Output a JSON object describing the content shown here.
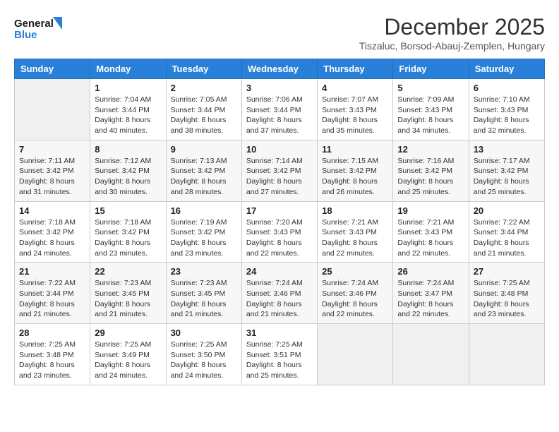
{
  "header": {
    "logo_line1": "General",
    "logo_line2": "Blue",
    "month_title": "December 2025",
    "location": "Tiszaluc, Borsod-Abauj-Zemplen, Hungary"
  },
  "days_of_week": [
    "Sunday",
    "Monday",
    "Tuesday",
    "Wednesday",
    "Thursday",
    "Friday",
    "Saturday"
  ],
  "weeks": [
    [
      {
        "day": "",
        "info": ""
      },
      {
        "day": "1",
        "info": "Sunrise: 7:04 AM\nSunset: 3:44 PM\nDaylight: 8 hours\nand 40 minutes."
      },
      {
        "day": "2",
        "info": "Sunrise: 7:05 AM\nSunset: 3:44 PM\nDaylight: 8 hours\nand 38 minutes."
      },
      {
        "day": "3",
        "info": "Sunrise: 7:06 AM\nSunset: 3:44 PM\nDaylight: 8 hours\nand 37 minutes."
      },
      {
        "day": "4",
        "info": "Sunrise: 7:07 AM\nSunset: 3:43 PM\nDaylight: 8 hours\nand 35 minutes."
      },
      {
        "day": "5",
        "info": "Sunrise: 7:09 AM\nSunset: 3:43 PM\nDaylight: 8 hours\nand 34 minutes."
      },
      {
        "day": "6",
        "info": "Sunrise: 7:10 AM\nSunset: 3:43 PM\nDaylight: 8 hours\nand 32 minutes."
      }
    ],
    [
      {
        "day": "7",
        "info": "Sunrise: 7:11 AM\nSunset: 3:42 PM\nDaylight: 8 hours\nand 31 minutes."
      },
      {
        "day": "8",
        "info": "Sunrise: 7:12 AM\nSunset: 3:42 PM\nDaylight: 8 hours\nand 30 minutes."
      },
      {
        "day": "9",
        "info": "Sunrise: 7:13 AM\nSunset: 3:42 PM\nDaylight: 8 hours\nand 28 minutes."
      },
      {
        "day": "10",
        "info": "Sunrise: 7:14 AM\nSunset: 3:42 PM\nDaylight: 8 hours\nand 27 minutes."
      },
      {
        "day": "11",
        "info": "Sunrise: 7:15 AM\nSunset: 3:42 PM\nDaylight: 8 hours\nand 26 minutes."
      },
      {
        "day": "12",
        "info": "Sunrise: 7:16 AM\nSunset: 3:42 PM\nDaylight: 8 hours\nand 25 minutes."
      },
      {
        "day": "13",
        "info": "Sunrise: 7:17 AM\nSunset: 3:42 PM\nDaylight: 8 hours\nand 25 minutes."
      }
    ],
    [
      {
        "day": "14",
        "info": "Sunrise: 7:18 AM\nSunset: 3:42 PM\nDaylight: 8 hours\nand 24 minutes."
      },
      {
        "day": "15",
        "info": "Sunrise: 7:18 AM\nSunset: 3:42 PM\nDaylight: 8 hours\nand 23 minutes."
      },
      {
        "day": "16",
        "info": "Sunrise: 7:19 AM\nSunset: 3:42 PM\nDaylight: 8 hours\nand 23 minutes."
      },
      {
        "day": "17",
        "info": "Sunrise: 7:20 AM\nSunset: 3:43 PM\nDaylight: 8 hours\nand 22 minutes."
      },
      {
        "day": "18",
        "info": "Sunrise: 7:21 AM\nSunset: 3:43 PM\nDaylight: 8 hours\nand 22 minutes."
      },
      {
        "day": "19",
        "info": "Sunrise: 7:21 AM\nSunset: 3:43 PM\nDaylight: 8 hours\nand 22 minutes."
      },
      {
        "day": "20",
        "info": "Sunrise: 7:22 AM\nSunset: 3:44 PM\nDaylight: 8 hours\nand 21 minutes."
      }
    ],
    [
      {
        "day": "21",
        "info": "Sunrise: 7:22 AM\nSunset: 3:44 PM\nDaylight: 8 hours\nand 21 minutes."
      },
      {
        "day": "22",
        "info": "Sunrise: 7:23 AM\nSunset: 3:45 PM\nDaylight: 8 hours\nand 21 minutes."
      },
      {
        "day": "23",
        "info": "Sunrise: 7:23 AM\nSunset: 3:45 PM\nDaylight: 8 hours\nand 21 minutes."
      },
      {
        "day": "24",
        "info": "Sunrise: 7:24 AM\nSunset: 3:46 PM\nDaylight: 8 hours\nand 21 minutes."
      },
      {
        "day": "25",
        "info": "Sunrise: 7:24 AM\nSunset: 3:46 PM\nDaylight: 8 hours\nand 22 minutes."
      },
      {
        "day": "26",
        "info": "Sunrise: 7:24 AM\nSunset: 3:47 PM\nDaylight: 8 hours\nand 22 minutes."
      },
      {
        "day": "27",
        "info": "Sunrise: 7:25 AM\nSunset: 3:48 PM\nDaylight: 8 hours\nand 23 minutes."
      }
    ],
    [
      {
        "day": "28",
        "info": "Sunrise: 7:25 AM\nSunset: 3:48 PM\nDaylight: 8 hours\nand 23 minutes."
      },
      {
        "day": "29",
        "info": "Sunrise: 7:25 AM\nSunset: 3:49 PM\nDaylight: 8 hours\nand 24 minutes."
      },
      {
        "day": "30",
        "info": "Sunrise: 7:25 AM\nSunset: 3:50 PM\nDaylight: 8 hours\nand 24 minutes."
      },
      {
        "day": "31",
        "info": "Sunrise: 7:25 AM\nSunset: 3:51 PM\nDaylight: 8 hours\nand 25 minutes."
      },
      {
        "day": "",
        "info": ""
      },
      {
        "day": "",
        "info": ""
      },
      {
        "day": "",
        "info": ""
      }
    ]
  ]
}
